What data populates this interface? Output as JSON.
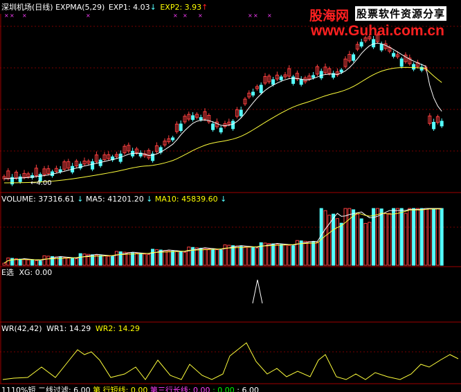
{
  "colors": {
    "bg": "#000000",
    "up": "#ff4040",
    "down": "#55ffff",
    "ma_white": "#ffffff",
    "ma_yellow": "#ffff3c",
    "grid": "#7a0000",
    "label": "#ffffff",
    "yellow": "#ffff00",
    "magenta": "#ff40ff",
    "arrow_up": "#ff2020",
    "arrow_down": "#55ffff",
    "wm_red": "#ff2020",
    "wm_box": "#ffffff"
  },
  "watermark": {
    "logo": "股海网",
    "slogan": "股票软件资源分享",
    "url": "www.Guhai.com.cn"
  },
  "panels": {
    "price": {
      "name": "深圳机场(日线)",
      "indicator": "EXPMA(5,29)",
      "items": [
        {
          "label": "EXP1: 4.03",
          "arrow": "down"
        },
        {
          "label": "EXP2: 3.93",
          "arrow": "up"
        }
      ],
      "low_mark": "4.00",
      "icon": "down-arrow-icon"
    },
    "volume": {
      "items": [
        {
          "label": "VOLUME: 37316.61",
          "arrow": "down"
        },
        {
          "label": "MA5: 41201.20",
          "arrow": "down"
        },
        {
          "label": "MA10: 45839.60",
          "arrow": "down"
        }
      ]
    },
    "signal": {
      "name": "E选",
      "value": "XG: 0.00"
    },
    "wr": {
      "name": "WR(42,42)",
      "items": [
        {
          "label": "WR1: 14.29"
        },
        {
          "label": "WR2: 14.29"
        }
      ]
    },
    "bottom": {
      "items": [
        "1110%短",
        "二线过滤: 6.00",
        "第",
        "行短线: 0.00",
        "第三行长线: 0.00",
        ": 0.00",
        ": 6.00"
      ]
    }
  }
}
